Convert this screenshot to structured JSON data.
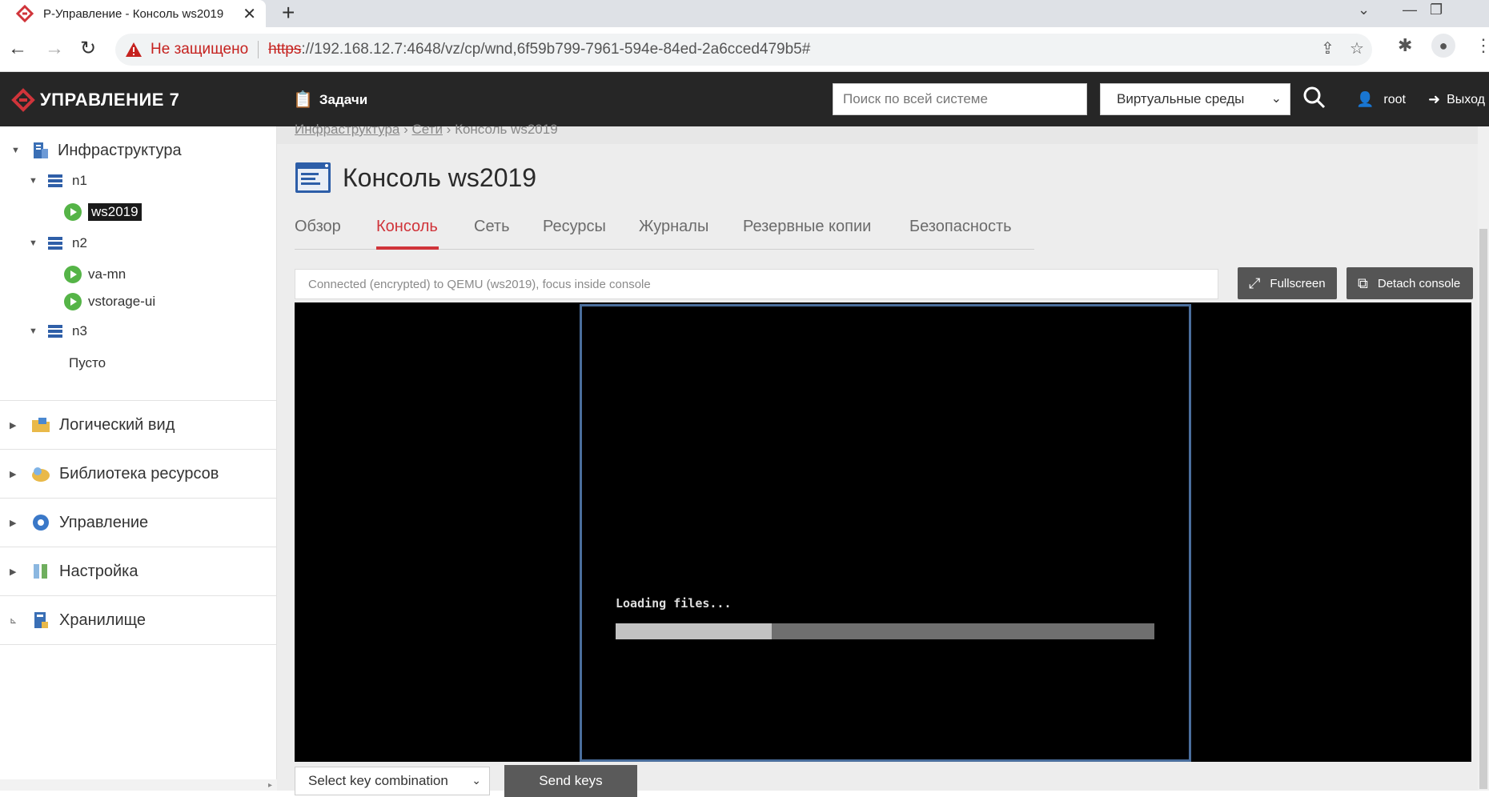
{
  "browser": {
    "tab_title": "Р-Управление - Консоль ws2019",
    "insecure_label": "Не защищено",
    "url_protocol": "https",
    "url_rest": "://192.168.12.7:4648/vz/cp/wnd,6f59b799-7961-594e-84ed-2a6cced479b5#"
  },
  "appbar": {
    "logo_text": "УПРАВЛЕНИЕ 7",
    "tasks_label": "Задачи",
    "search_placeholder": "Поиск по всей системе",
    "env_select_value": "Виртуальные среды",
    "user_label": "root",
    "logout_label": "Выход"
  },
  "sidebar": {
    "tree": {
      "root": "Инфраструктура",
      "nodes": [
        {
          "label": "n1",
          "vms": [
            "ws2019"
          ]
        },
        {
          "label": "n2",
          "vms": [
            "va-mn",
            "vstorage-ui"
          ]
        },
        {
          "label": "n3",
          "empty": "Пусто"
        }
      ]
    },
    "categories": [
      "Логический вид",
      "Библиотека ресурсов",
      "Управление",
      "Настройка",
      "Хранилище"
    ]
  },
  "main": {
    "breadcrumb": [
      "Инфраструктура",
      "Сети",
      "Консоль ws2019"
    ],
    "title": "Консоль ws2019",
    "tabs": [
      "Обзор",
      "Консоль",
      "Сеть",
      "Ресурсы",
      "Журналы",
      "Резервные копии",
      "Безопасность"
    ],
    "active_tab": "Консоль",
    "status_text": "Connected (encrypted) to QEMU (ws2019), focus inside console",
    "fullscreen_label": "Fullscreen",
    "detach_label": "Detach console",
    "console_text": "Loading files...",
    "loading_progress": 0.29,
    "key_select_value": "Select key combination",
    "send_keys_label": "Send keys"
  },
  "colors": {
    "accent": "#d0343a",
    "appbar_bg": "#262626",
    "vm_running": "#55b447",
    "console_border": "#4a6e9c"
  }
}
